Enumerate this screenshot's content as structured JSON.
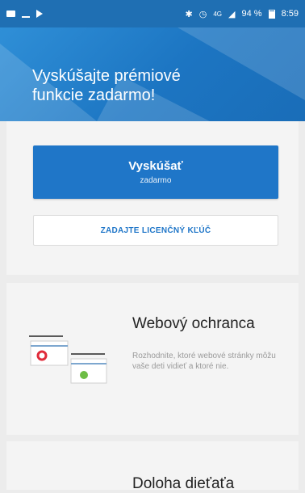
{
  "status_bar": {
    "network": "4G",
    "battery_percent": "94 %",
    "time": "8:59",
    "icons": [
      "message-icon",
      "signal-icon",
      "play-icon",
      "bluetooth-icon",
      "alarm-icon",
      "network-icon",
      "cellular-signal-icon",
      "battery-icon"
    ]
  },
  "header": {
    "title_line1": "Vyskúšajte prémiové",
    "title_line2": "funkcie zadarmo!"
  },
  "cta": {
    "try_label": "Vyskúšať",
    "try_sublabel": "zadarmo",
    "license_label": "ZADAJTE LICENČNÝ KĽÚČ"
  },
  "features": [
    {
      "title": "Webový ochranca",
      "description": "Rozhodnite, ktoré webové stránky môžu vaše deti vidieť a ktoré nie.",
      "icon": "web-guard-illustration"
    },
    {
      "title": "Doloha dieťaťa",
      "description": "",
      "icon": ""
    }
  ],
  "colors": {
    "accent": "#1f76c8",
    "header_start": "#2f8fd7",
    "header_end": "#1a6db8",
    "background": "#ececec",
    "card": "#f4f4f4"
  }
}
